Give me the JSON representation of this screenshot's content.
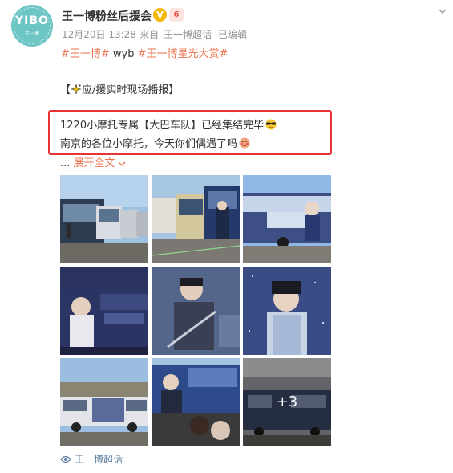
{
  "post": {
    "avatar_text": "YIBO",
    "avatar_subtext": "王一博",
    "author": "王一博粉丝后援会",
    "verified_badge": "V",
    "fan_badge": "6",
    "time": "12月20日 13:28",
    "source_prefix": "来自",
    "source": "王一博超话",
    "edited": "已编辑",
    "topics": [
      {
        "text": "#王一博#",
        "type": "topic"
      },
      {
        "text": " wyb ",
        "type": "plain"
      },
      {
        "text": "#王一博星光大赏#",
        "type": "topic"
      }
    ],
    "line1_prefix": "【",
    "line1_text": "应/援实时现场播报】",
    "line2": "1220小摩托专属【大巴车队】已经集结完毕",
    "line3": "南京的各位小摩托，今天你们偶遇了吗",
    "ellipsis": "...",
    "expand_label": "展开全文",
    "more_count": "+3",
    "footer_source": "王一博超话"
  },
  "colors": {
    "link": "#eb7350",
    "highlight_border": "#e63232",
    "meta": "#939393",
    "avatar_bg": "#6ec6c4"
  },
  "icons": [
    "chevron-down-icon",
    "sparkle-icon",
    "sunglasses-emoji-icon",
    "shy-face-emoji-icon",
    "supertopic-icon"
  ]
}
